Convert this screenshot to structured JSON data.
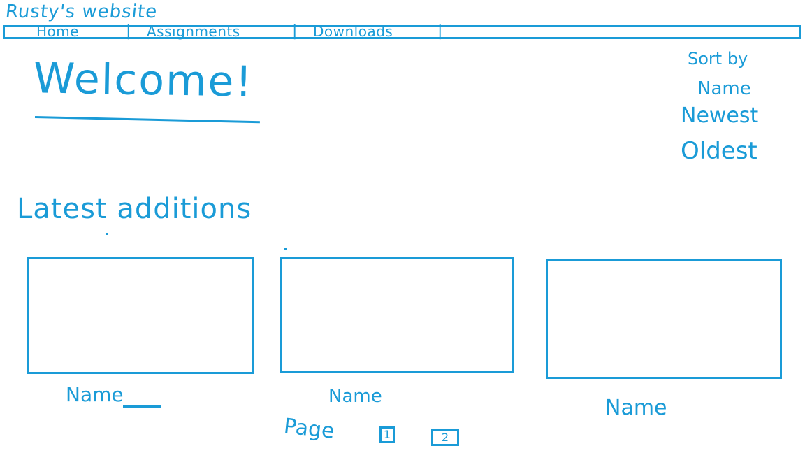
{
  "header": {
    "site_title": "Rusty's website"
  },
  "nav": {
    "items": [
      "Home",
      "Assignments",
      "Downloads"
    ],
    "separator": "|"
  },
  "welcome": {
    "heading": "Welcome!"
  },
  "sort": {
    "label": "Sort by",
    "options": [
      "Name",
      "Newest",
      "Oldest"
    ]
  },
  "latest": {
    "heading": "Latest additions",
    "cards": [
      {
        "name": "Name"
      },
      {
        "name": "Name"
      },
      {
        "name": "Name"
      }
    ]
  },
  "pagination": {
    "label": "Page",
    "pages": [
      "1",
      "2"
    ]
  },
  "colors": {
    "ink": "#1a9bd7"
  }
}
